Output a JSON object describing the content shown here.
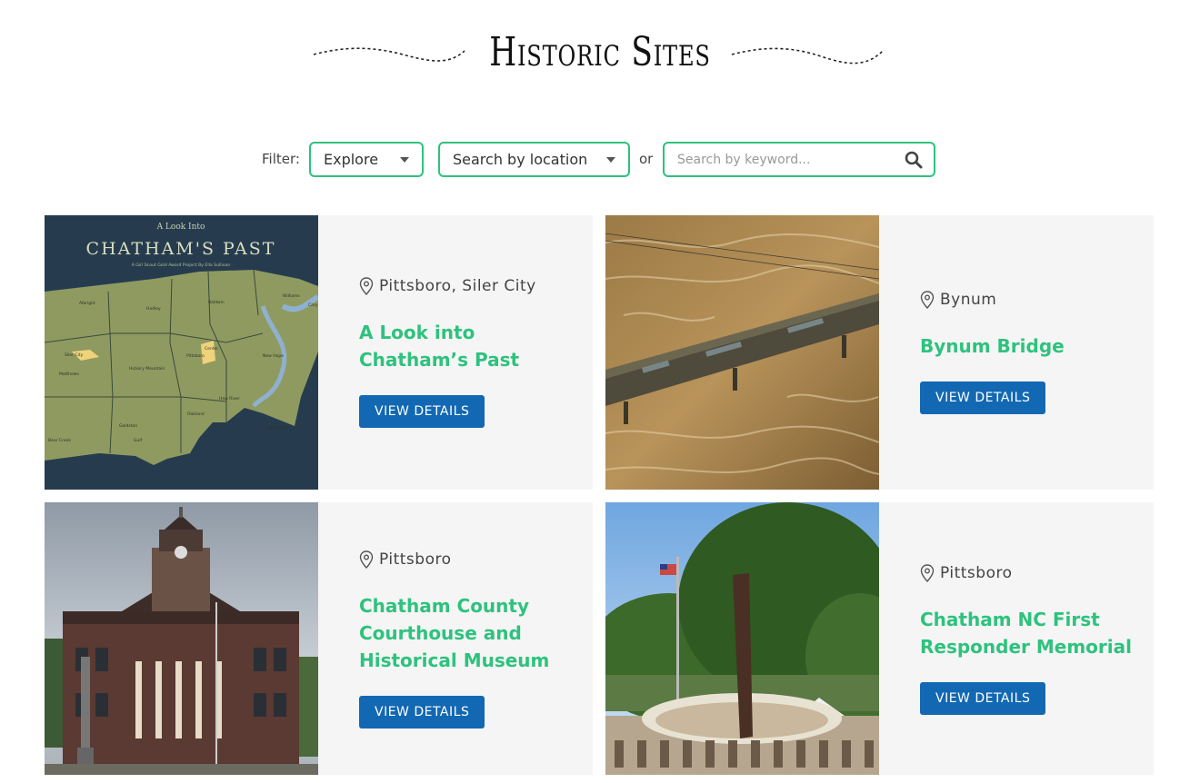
{
  "page": {
    "title": "Historic Sites"
  },
  "filter": {
    "label": "Filter:",
    "explore_value": "Explore",
    "location_value": "Search by location",
    "or_label": "or",
    "keyword_placeholder": "Search by keyword..."
  },
  "map_thumbnail": {
    "small_title": "A Look Into",
    "big_title": "CHATHAM'S PAST",
    "subtitle": "A Girl Scout Gold Award Project By Ella Sullivan",
    "towns": [
      "Albright",
      "Hadley",
      "Baldwin",
      "Williams",
      "Cary",
      "Siler City",
      "Matthews",
      "Hickory Mountain",
      "Center",
      "Pittsboro",
      "New Hope",
      "Haw River",
      "Oakland",
      "Cape Fear",
      "Bear Creek",
      "Gulf",
      "Goldston"
    ]
  },
  "cards": [
    {
      "location": "Pittsboro, Siler City",
      "name": "A Look into Chatham’s Past",
      "button": "VIEW DETAILS"
    },
    {
      "location": "Bynum",
      "name": "Bynum Bridge",
      "button": "VIEW DETAILS"
    },
    {
      "location": "Pittsboro",
      "name": "Chatham County Courthouse and Historical Museum",
      "button": "VIEW DETAILS"
    },
    {
      "location": "Pittsboro",
      "name": "Chatham NC First Responder Memorial",
      "button": "VIEW DETAILS"
    }
  ],
  "colors": {
    "accent_green": "#2ec27e",
    "button_blue": "#1268b3",
    "card_bg": "#f5f5f5"
  },
  "icons": {
    "location": "map-pin-icon",
    "search": "search-icon",
    "dropdown": "chevron-down-icon"
  }
}
